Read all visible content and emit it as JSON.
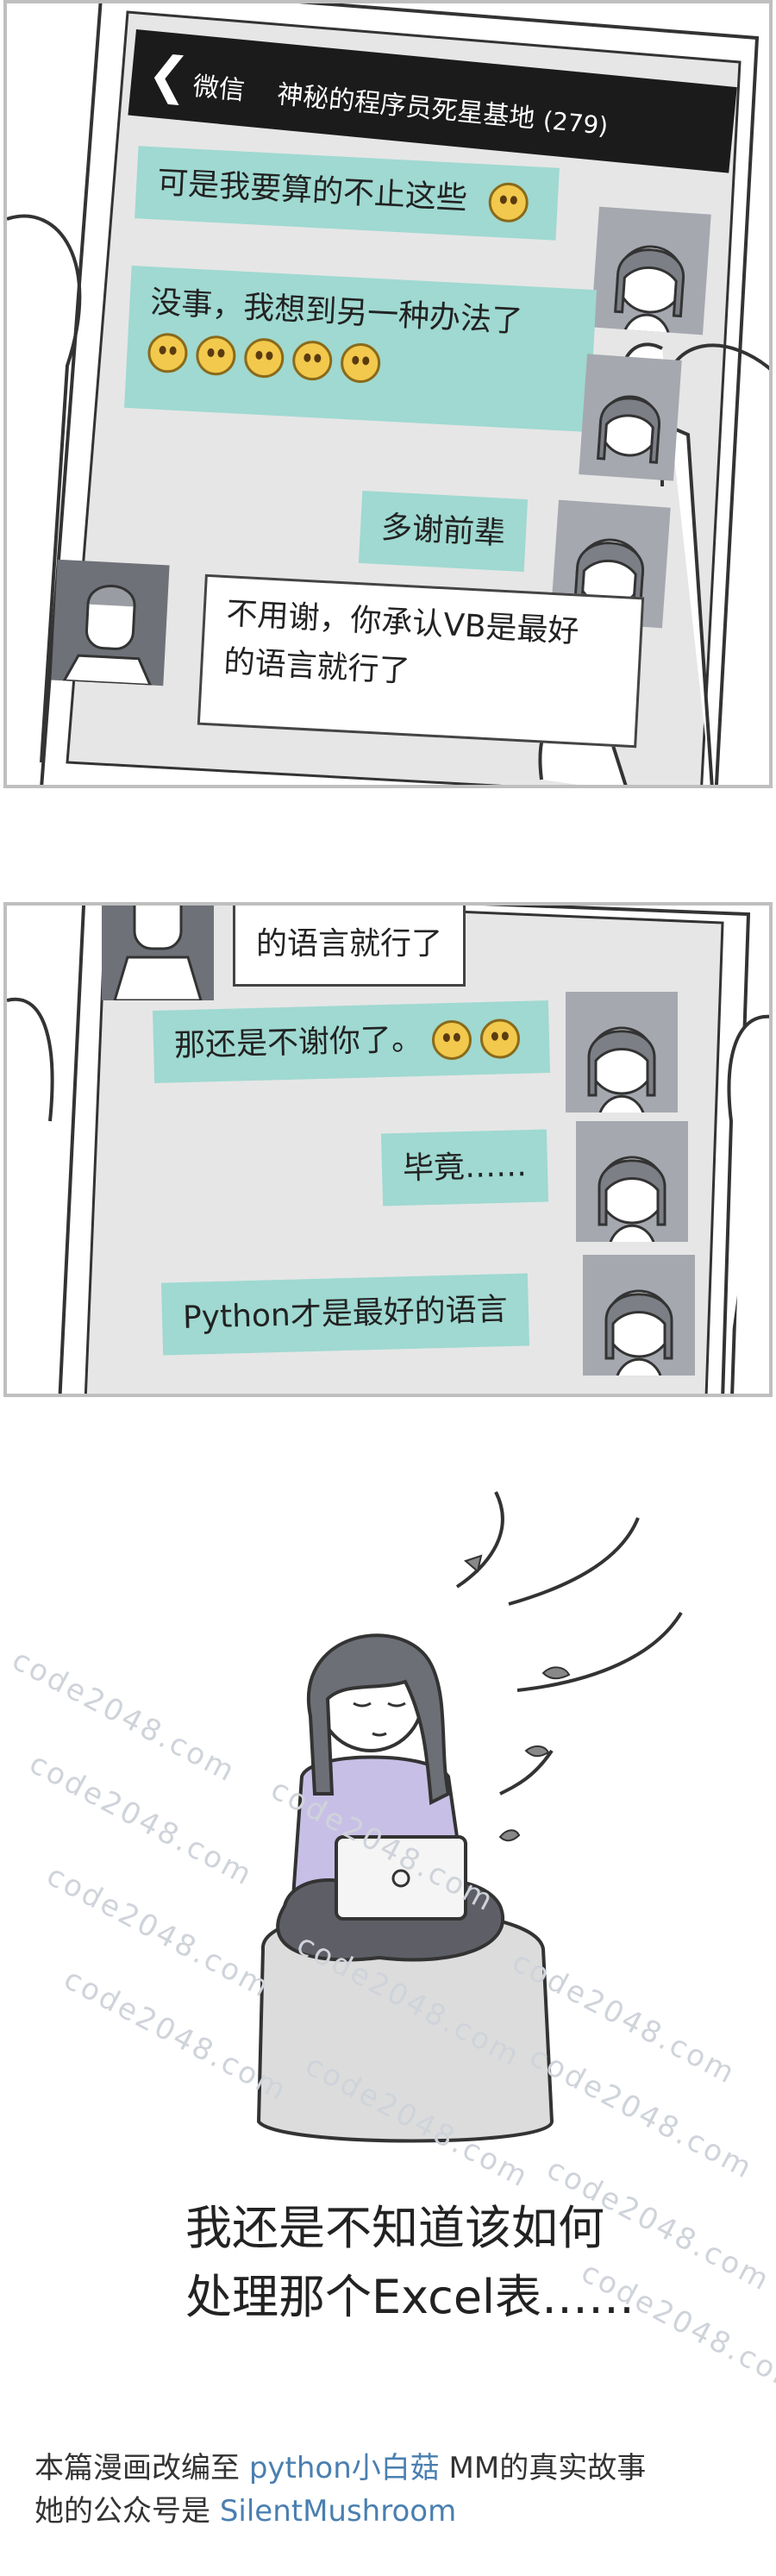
{
  "phone_header": {
    "back_glyph": "❮",
    "app_label": "微信",
    "group_name": "神秘的程序员死星基地",
    "member_count": "(279)"
  },
  "chat1": [
    {
      "text": "可是我要算的不止这些",
      "emoji_count": 1
    },
    {
      "text": "没事，我想到另一种办法了",
      "emoji_count": 5
    },
    {
      "text": "多谢前辈",
      "emoji_count": 0
    },
    {
      "text_line1": "不用谢，你承认VB是最好",
      "text_line2": "的语言就行了"
    }
  ],
  "chat2": [
    {
      "text": "的语言就行了"
    },
    {
      "text": "那还是不谢你了。",
      "emoji_count": 2
    },
    {
      "text": "毕竟……"
    },
    {
      "text": "Python才是最好的语言"
    }
  ],
  "caption": {
    "line1": "我还是不知道该如何",
    "line2": "处理那个Excel表……"
  },
  "watermark": "code2048.com",
  "footer": {
    "line1_a": "本篇漫画改编至 ",
    "line1_b": "python小白菇",
    "line1_c": " MM的真实故事",
    "line2_a": "她的公众号是 ",
    "line2_b": "SilentMushroom"
  },
  "colors": {
    "bubble_green": "#9fd9d1",
    "screen_gray": "#e6e6e6",
    "avatar_gray": "#a6a8b0",
    "sweater": "#c8bfe6",
    "cushion": "#dcdcdc",
    "footer_accent": "#4a7fb0"
  }
}
